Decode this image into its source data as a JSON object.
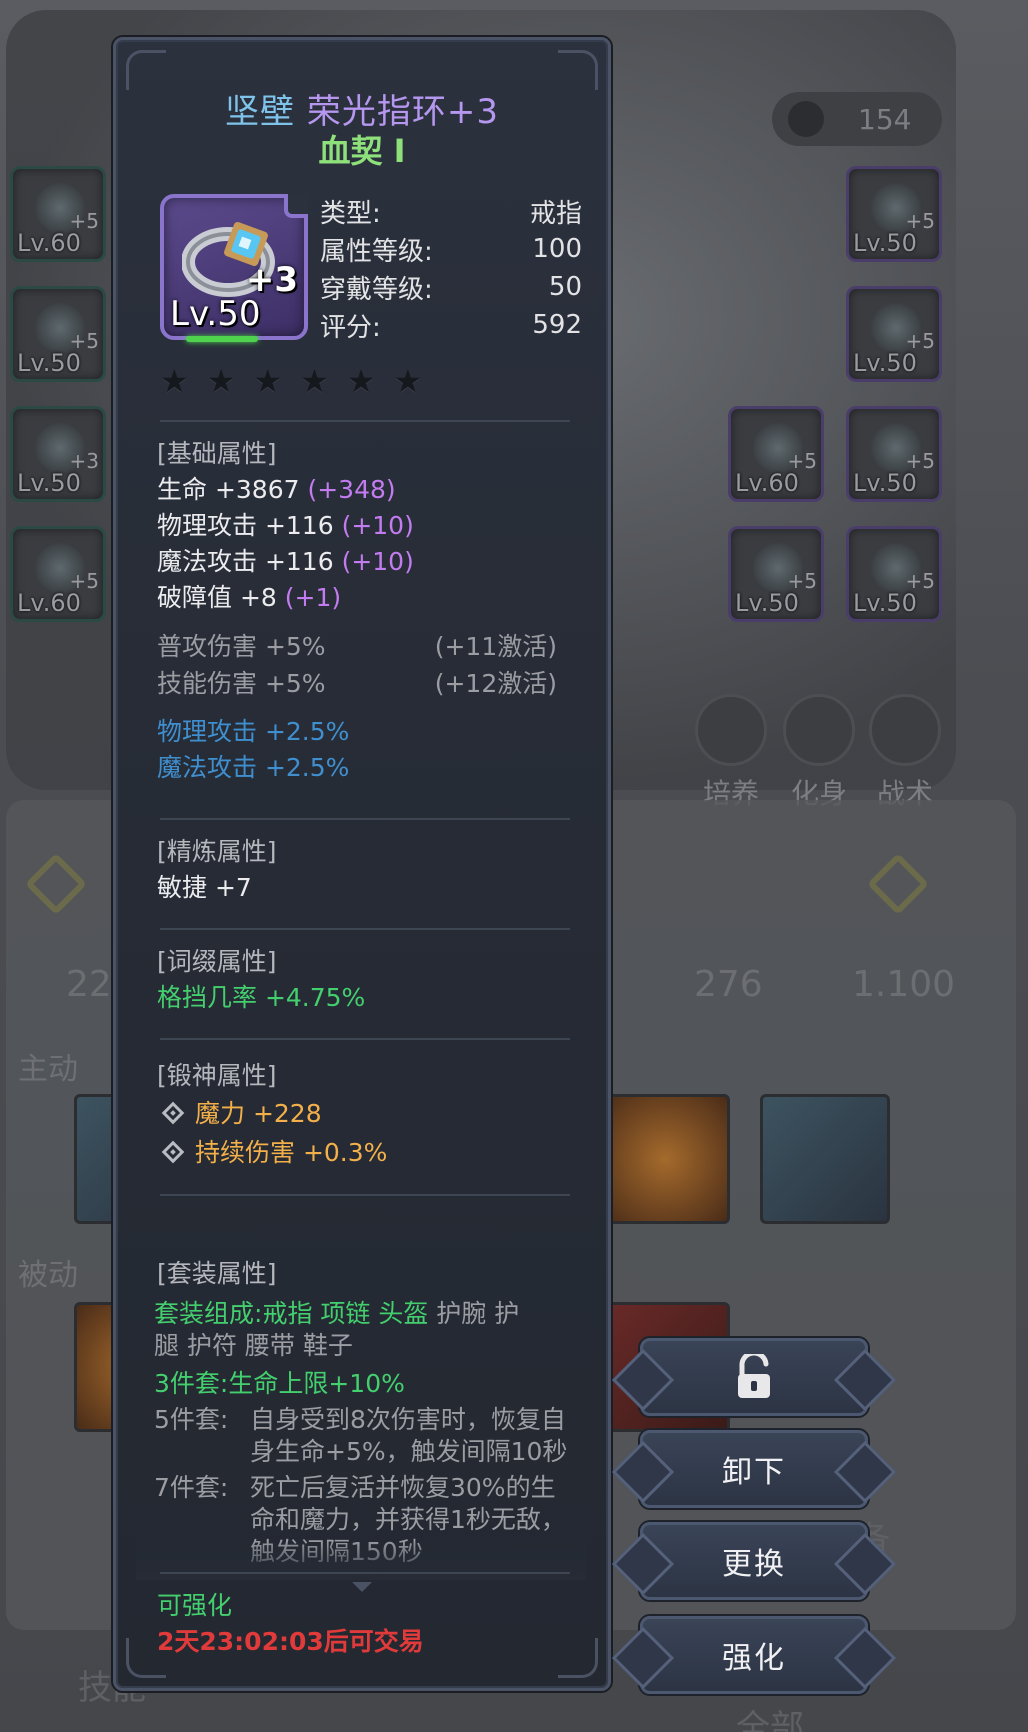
{
  "background": {
    "score": "154",
    "left_slots": [
      {
        "level": "Lv.60",
        "plus": "+5"
      },
      {
        "level": "Lv.50",
        "plus": "+5"
      },
      {
        "level": "Lv.50",
        "plus": "+3"
      },
      {
        "level": "Lv.60",
        "plus": "+5"
      }
    ],
    "right_slots": [
      {
        "level": "Lv.50",
        "plus": "+5"
      },
      {
        "level": "Lv.50",
        "plus": "+5"
      },
      {
        "level": "Lv.60",
        "plus": "+5"
      },
      {
        "level": "Lv.50",
        "plus": "+5"
      },
      {
        "level": "Lv.50",
        "plus": "+5"
      },
      {
        "level": "Lv.50",
        "plus": "+5"
      }
    ],
    "tabs": [
      "培养",
      "化身",
      "战术"
    ],
    "stats": [
      "22",
      "276",
      "1.100"
    ],
    "sections": [
      "主动",
      "被动"
    ],
    "bottom": [
      "技能",
      "备",
      "全部"
    ]
  },
  "item": {
    "quality": "坚壁",
    "name": "荣光指环+3",
    "subtitle": "血契 I",
    "icon": "ring-icon",
    "plus": "+3",
    "level": "Lv.50",
    "info": [
      {
        "label": "类型:",
        "value": "戒指"
      },
      {
        "label": "属性等级:",
        "value": "100"
      },
      {
        "label": "穿戴等级:",
        "value": "50"
      },
      {
        "label": "评分:",
        "value": "592"
      }
    ],
    "stars": [
      "★",
      "★",
      "★",
      "★",
      "★",
      "★"
    ]
  },
  "base": {
    "header": "[基础属性]",
    "rows": [
      {
        "text": "生命 +3867",
        "bonus": "(+348)"
      },
      {
        "text": "物理攻击 +116",
        "bonus": "(+10)"
      },
      {
        "text": "魔法攻击 +116",
        "bonus": "(+10)"
      },
      {
        "text": "破障值 +8",
        "bonus": "(+1)"
      }
    ],
    "locked": [
      {
        "text": "普攻伤害 +5%",
        "req": "(+11激活)"
      },
      {
        "text": "技能伤害 +5%",
        "req": "(+12激活)"
      }
    ],
    "extra": [
      "物理攻击 +2.5%",
      "魔法攻击 +2.5%"
    ]
  },
  "refine": {
    "header": "[精炼属性]",
    "value": "敏捷 +7"
  },
  "affix": {
    "header": "[词缀属性]",
    "value": "格挡几率 +4.75%"
  },
  "forge": {
    "header": "[锻神属性]",
    "rows": [
      "魔力 +228",
      "持续伤害 +0.3%"
    ]
  },
  "set": {
    "header": "[套装属性]",
    "comp_label": "套装组成:",
    "owned": "戒指 项链 头盔",
    "missing_1": "护腕 护",
    "missing_2": "腿 护符 腰带 鞋子",
    "t3_label": "3件套:",
    "t3_value": "生命上限+10%",
    "t5_label": "5件套:",
    "t5_value": "自身受到8次伤害时，恢复自身生命+5%，触发间隔10秒",
    "t7_label": "7件套:",
    "t7_value": "死亡后复活并恢复30%的生命和魔力，并获得1秒无敌，触发间隔150秒"
  },
  "footer": {
    "upgradable": "可强化",
    "trade": "2天23:02:03后可交易"
  },
  "buttons": {
    "unlock_icon": "unlock-icon",
    "unequip": "卸下",
    "replace": "更换",
    "enhance": "强化"
  },
  "colors": {
    "quality": "#7fc3ea",
    "name": "#b697f0",
    "bonus": "#c27cf0",
    "set_active": "#44cf6e",
    "trade": "#e03a3a",
    "forge": "#f3b04a"
  }
}
